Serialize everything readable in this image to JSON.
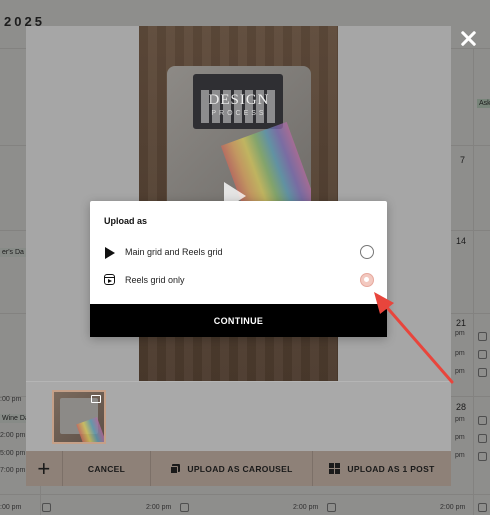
{
  "calendar": {
    "year": "2025",
    "day_numbers": [
      "7",
      "14",
      "21",
      "28"
    ],
    "events": {
      "e1": "Wine Da",
      "e2": "er's Da",
      "e3": "Aske"
    },
    "times": {
      "t1": ":00 pm",
      "t2": "2:00 pm",
      "t3": "2:00 pm",
      "t4": "5:00 pm",
      "t5": "7:00 pm",
      "t6": ":00 pm",
      "t7": "2:00 pm",
      "t8": "2:00 pm",
      "t9": "pm",
      "t10": "pm",
      "t11": "pm",
      "t12": "pm",
      "t13": "pm",
      "t14": "pm"
    }
  },
  "modal": {
    "preview": {
      "card_title": "DESIGN",
      "card_subtitle": "PROCESS"
    },
    "toolbar": {
      "add_label": "+",
      "cancel_label": "CANCEL",
      "carousel_label": "UPLOAD AS CAROUSEL",
      "single_post_label": "UPLOAD AS 1 POST"
    }
  },
  "dialog": {
    "title": "Upload as",
    "options": [
      {
        "label": "Main grid and Reels grid",
        "icon": "play-icon",
        "selected": false
      },
      {
        "label": "Reels grid only",
        "icon": "reels-icon",
        "selected": true
      }
    ],
    "continue_label": "CONTINUE"
  },
  "colors": {
    "overlay": "#000000",
    "toolbar": "#8e8178",
    "selected_radio": "#f3c9c0",
    "annotation_arrow": "#e8453c"
  }
}
